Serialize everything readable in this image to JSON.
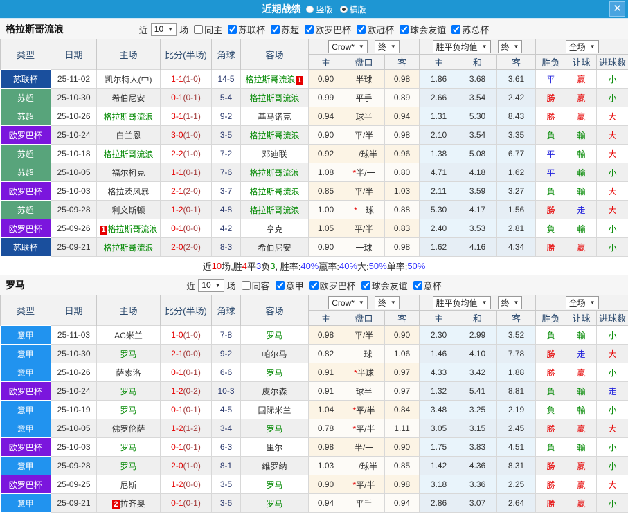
{
  "topbar": {
    "title": "近期战绩",
    "radios": [
      {
        "label": "竖版",
        "selected": false
      },
      {
        "label": "横版",
        "selected": true
      }
    ],
    "close": "✕"
  },
  "table_header": {
    "columns": [
      "类型",
      "日期",
      "主场",
      "比分(半场)",
      "角球",
      "客场"
    ],
    "subcolumns": [
      "主",
      "盘口",
      "客",
      "主",
      "和",
      "客",
      "胜负",
      "让球",
      "进球数"
    ],
    "selects": {
      "odds": "Crow*",
      "final1": "终",
      "avg": "胜平负均值",
      "final2": "终",
      "scope": "全场"
    },
    "near_label": "近",
    "match_label": "场"
  },
  "colors": {
    "league": {
      "苏联杯": "#1a4f9d",
      "苏超": "#58a47b",
      "欧罗巴杯": "#7b16dd",
      "意甲": "#2193ef"
    },
    "accent_blue": "#1e96d3",
    "score_red": "#e60000",
    "team_green": "#008800"
  },
  "sections": [
    {
      "team": "格拉斯哥流浪",
      "near_count": "10",
      "same_label": "同主",
      "same_checked": false,
      "leagues": [
        "苏联杯",
        "苏超",
        "欧罗巴杯",
        "欧冠杯",
        "球会友谊",
        "苏总杯"
      ],
      "rows": [
        {
          "type": "苏联杯",
          "date": "25-11-02",
          "home": {
            "name": "凯尔特人(中)"
          },
          "ft": "1-1",
          "ht": "(1-0)",
          "corner": "14-5",
          "away": {
            "name": "格拉斯哥流浪",
            "green": true,
            "badge": "1",
            "badge_pos": "after"
          },
          "odds": [
            "0.90",
            "半球",
            "0.98"
          ],
          "avg": [
            "1.86",
            "3.68",
            "3.61"
          ],
          "res": [
            "平",
            "贏",
            "小"
          ]
        },
        {
          "type": "苏超",
          "date": "25-10-30",
          "home": {
            "name": "希伯尼安"
          },
          "ft": "0-1",
          "ht": "(0-1)",
          "corner": "5-4",
          "away": {
            "name": "格拉斯哥流浪",
            "green": true
          },
          "odds": [
            "0.99",
            "平手",
            "0.89"
          ],
          "avg": [
            "2.66",
            "3.54",
            "2.42"
          ],
          "res": [
            "勝",
            "贏",
            "小"
          ]
        },
        {
          "type": "苏超",
          "date": "25-10-26",
          "home": {
            "name": "格拉斯哥流浪",
            "green": true
          },
          "ft": "3-1",
          "ht": "(1-1)",
          "corner": "9-2",
          "away": {
            "name": "基马诺克"
          },
          "odds": [
            "0.94",
            "球半",
            "0.94"
          ],
          "avg": [
            "1.31",
            "5.30",
            "8.43"
          ],
          "res": [
            "勝",
            "贏",
            "大"
          ]
        },
        {
          "type": "欧罗巴杯",
          "date": "25-10-24",
          "home": {
            "name": "白兰恩"
          },
          "ft": "3-0",
          "ht": "(1-0)",
          "corner": "3-5",
          "away": {
            "name": "格拉斯哥流浪",
            "green": true
          },
          "odds": [
            "0.90",
            "平/半",
            "0.98"
          ],
          "avg": [
            "2.10",
            "3.54",
            "3.35"
          ],
          "res": [
            "負",
            "輸",
            "大"
          ]
        },
        {
          "type": "苏超",
          "date": "25-10-18",
          "home": {
            "name": "格拉斯哥流浪",
            "green": true
          },
          "ft": "2-2",
          "ht": "(1-0)",
          "corner": "7-2",
          "away": {
            "name": "邓迪联"
          },
          "odds": [
            "0.92",
            "一/球半",
            "0.96"
          ],
          "avg": [
            "1.38",
            "5.08",
            "6.77"
          ],
          "res": [
            "平",
            "輸",
            "大"
          ]
        },
        {
          "type": "苏超",
          "date": "25-10-05",
          "home": {
            "name": "福尔柯克"
          },
          "ft": "1-1",
          "ht": "(0-1)",
          "corner": "7-6",
          "away": {
            "name": "格拉斯哥流浪",
            "green": true
          },
          "odds": [
            "1.08",
            "*半/一",
            "0.80"
          ],
          "avg": [
            "4.71",
            "4.18",
            "1.62"
          ],
          "res": [
            "平",
            "輸",
            "小"
          ]
        },
        {
          "type": "欧罗巴杯",
          "date": "25-10-03",
          "home": {
            "name": "格拉茨风暴"
          },
          "ft": "2-1",
          "ht": "(2-0)",
          "corner": "3-7",
          "away": {
            "name": "格拉斯哥流浪",
            "green": true
          },
          "odds": [
            "0.85",
            "平/半",
            "1.03"
          ],
          "avg": [
            "2.11",
            "3.59",
            "3.27"
          ],
          "res": [
            "負",
            "輸",
            "大"
          ]
        },
        {
          "type": "苏超",
          "date": "25-09-28",
          "home": {
            "name": "利文斯顿"
          },
          "ft": "1-2",
          "ht": "(0-1)",
          "corner": "4-8",
          "away": {
            "name": "格拉斯哥流浪",
            "green": true
          },
          "odds": [
            "1.00",
            "*一球",
            "0.88"
          ],
          "avg": [
            "5.30",
            "4.17",
            "1.56"
          ],
          "res": [
            "勝",
            "走",
            "大"
          ]
        },
        {
          "type": "欧罗巴杯",
          "date": "25-09-26",
          "home": {
            "name": "格拉斯哥流浪",
            "green": true,
            "badge": "1",
            "badge_pos": "before"
          },
          "ft": "0-1",
          "ht": "(0-0)",
          "corner": "4-2",
          "away": {
            "name": "亨克"
          },
          "odds": [
            "1.05",
            "平/半",
            "0.83"
          ],
          "avg": [
            "2.40",
            "3.53",
            "2.81"
          ],
          "res": [
            "負",
            "輸",
            "小"
          ]
        },
        {
          "type": "苏联杯",
          "date": "25-09-21",
          "home": {
            "name": "格拉斯哥流浪",
            "green": true
          },
          "ft": "2-0",
          "ht": "(2-0)",
          "corner": "8-3",
          "away": {
            "name": "希伯尼安"
          },
          "odds": [
            "0.90",
            "一球",
            "0.98"
          ],
          "avg": [
            "1.62",
            "4.16",
            "4.34"
          ],
          "res": [
            "勝",
            "贏",
            "小"
          ]
        }
      ],
      "summary": [
        {
          "t": "近",
          "c": "#333333"
        },
        {
          "t": "10",
          "c": "#e60000"
        },
        {
          "t": "场,胜",
          "c": "#333333"
        },
        {
          "t": "4",
          "c": "#e60000"
        },
        {
          "t": "平",
          "c": "#333333"
        },
        {
          "t": "3",
          "c": "#2222dd"
        },
        {
          "t": "负",
          "c": "#333333"
        },
        {
          "t": "3",
          "c": "#008800"
        },
        {
          "t": ", 胜率:",
          "c": "#333333"
        },
        {
          "t": "40%",
          "c": "#3333ff"
        },
        {
          "t": " 赢率:",
          "c": "#333333"
        },
        {
          "t": "40%",
          "c": "#3333ff"
        },
        {
          "t": " 大:",
          "c": "#333333"
        },
        {
          "t": "50%",
          "c": "#3333ff"
        },
        {
          "t": " 单率:",
          "c": "#333333"
        },
        {
          "t": "50%",
          "c": "#3333ff"
        }
      ]
    },
    {
      "team": "罗马",
      "near_count": "10",
      "same_label": "同客",
      "same_checked": false,
      "leagues": [
        "意甲",
        "欧罗巴杯",
        "球会友谊",
        "意杯"
      ],
      "rows": [
        {
          "type": "意甲",
          "date": "25-11-03",
          "home": {
            "name": "AC米兰"
          },
          "ft": "1-0",
          "ht": "(1-0)",
          "corner": "7-8",
          "away": {
            "name": "罗马",
            "green": true
          },
          "odds": [
            "0.98",
            "平/半",
            "0.90"
          ],
          "avg": [
            "2.30",
            "2.99",
            "3.52"
          ],
          "res": [
            "負",
            "輸",
            "小"
          ]
        },
        {
          "type": "意甲",
          "date": "25-10-30",
          "home": {
            "name": "罗马",
            "green": true
          },
          "ft": "2-1",
          "ht": "(0-0)",
          "corner": "9-2",
          "away": {
            "name": "帕尔马"
          },
          "odds": [
            "0.82",
            "一球",
            "1.06"
          ],
          "avg": [
            "1.46",
            "4.10",
            "7.78"
          ],
          "res": [
            "勝",
            "走",
            "大"
          ]
        },
        {
          "type": "意甲",
          "date": "25-10-26",
          "home": {
            "name": "萨索洛"
          },
          "ft": "0-1",
          "ht": "(0-1)",
          "corner": "6-6",
          "away": {
            "name": "罗马",
            "green": true
          },
          "odds": [
            "0.91",
            "*半球",
            "0.97"
          ],
          "avg": [
            "4.33",
            "3.42",
            "1.88"
          ],
          "res": [
            "勝",
            "贏",
            "小"
          ]
        },
        {
          "type": "欧罗巴杯",
          "date": "25-10-24",
          "home": {
            "name": "罗马",
            "green": true
          },
          "ft": "1-2",
          "ht": "(0-2)",
          "corner": "10-3",
          "away": {
            "name": "皮尔森"
          },
          "odds": [
            "0.91",
            "球半",
            "0.97"
          ],
          "avg": [
            "1.32",
            "5.41",
            "8.81"
          ],
          "res": [
            "負",
            "輸",
            "走"
          ]
        },
        {
          "type": "意甲",
          "date": "25-10-19",
          "home": {
            "name": "罗马",
            "green": true
          },
          "ft": "0-1",
          "ht": "(0-1)",
          "corner": "4-5",
          "away": {
            "name": "国际米兰"
          },
          "odds": [
            "1.04",
            "*平/半",
            "0.84"
          ],
          "avg": [
            "3.48",
            "3.25",
            "2.19"
          ],
          "res": [
            "負",
            "輸",
            "小"
          ]
        },
        {
          "type": "意甲",
          "date": "25-10-05",
          "home": {
            "name": "佛罗伦萨"
          },
          "ft": "1-2",
          "ht": "(1-2)",
          "corner": "3-4",
          "away": {
            "name": "罗马",
            "green": true
          },
          "odds": [
            "0.78",
            "*平/半",
            "1.11"
          ],
          "avg": [
            "3.05",
            "3.15",
            "2.45"
          ],
          "res": [
            "勝",
            "贏",
            "大"
          ]
        },
        {
          "type": "欧罗巴杯",
          "date": "25-10-03",
          "home": {
            "name": "罗马",
            "green": true
          },
          "ft": "0-1",
          "ht": "(0-1)",
          "corner": "6-3",
          "away": {
            "name": "里尔"
          },
          "odds": [
            "0.98",
            "半/一",
            "0.90"
          ],
          "avg": [
            "1.75",
            "3.83",
            "4.51"
          ],
          "res": [
            "負",
            "輸",
            "小"
          ]
        },
        {
          "type": "意甲",
          "date": "25-09-28",
          "home": {
            "name": "罗马",
            "green": true
          },
          "ft": "2-0",
          "ht": "(1-0)",
          "corner": "8-1",
          "away": {
            "name": "维罗纳"
          },
          "odds": [
            "1.03",
            "一/球半",
            "0.85"
          ],
          "avg": [
            "1.42",
            "4.36",
            "8.31"
          ],
          "res": [
            "勝",
            "贏",
            "小"
          ]
        },
        {
          "type": "欧罗巴杯",
          "date": "25-09-25",
          "home": {
            "name": "尼斯"
          },
          "ft": "1-2",
          "ht": "(0-0)",
          "corner": "3-5",
          "away": {
            "name": "罗马",
            "green": true
          },
          "odds": [
            "0.90",
            "*平/半",
            "0.98"
          ],
          "avg": [
            "3.18",
            "3.36",
            "2.25"
          ],
          "res": [
            "勝",
            "贏",
            "大"
          ]
        },
        {
          "type": "意甲",
          "date": "25-09-21",
          "home": {
            "name": "拉齐奥",
            "badge": "2",
            "badge_pos": "before"
          },
          "ft": "0-1",
          "ht": "(0-1)",
          "corner": "3-6",
          "away": {
            "name": "罗马",
            "green": true
          },
          "odds": [
            "0.94",
            "平手",
            "0.94"
          ],
          "avg": [
            "2.86",
            "3.07",
            "2.64"
          ],
          "res": [
            "勝",
            "贏",
            "小"
          ]
        }
      ],
      "summary": null
    }
  ]
}
